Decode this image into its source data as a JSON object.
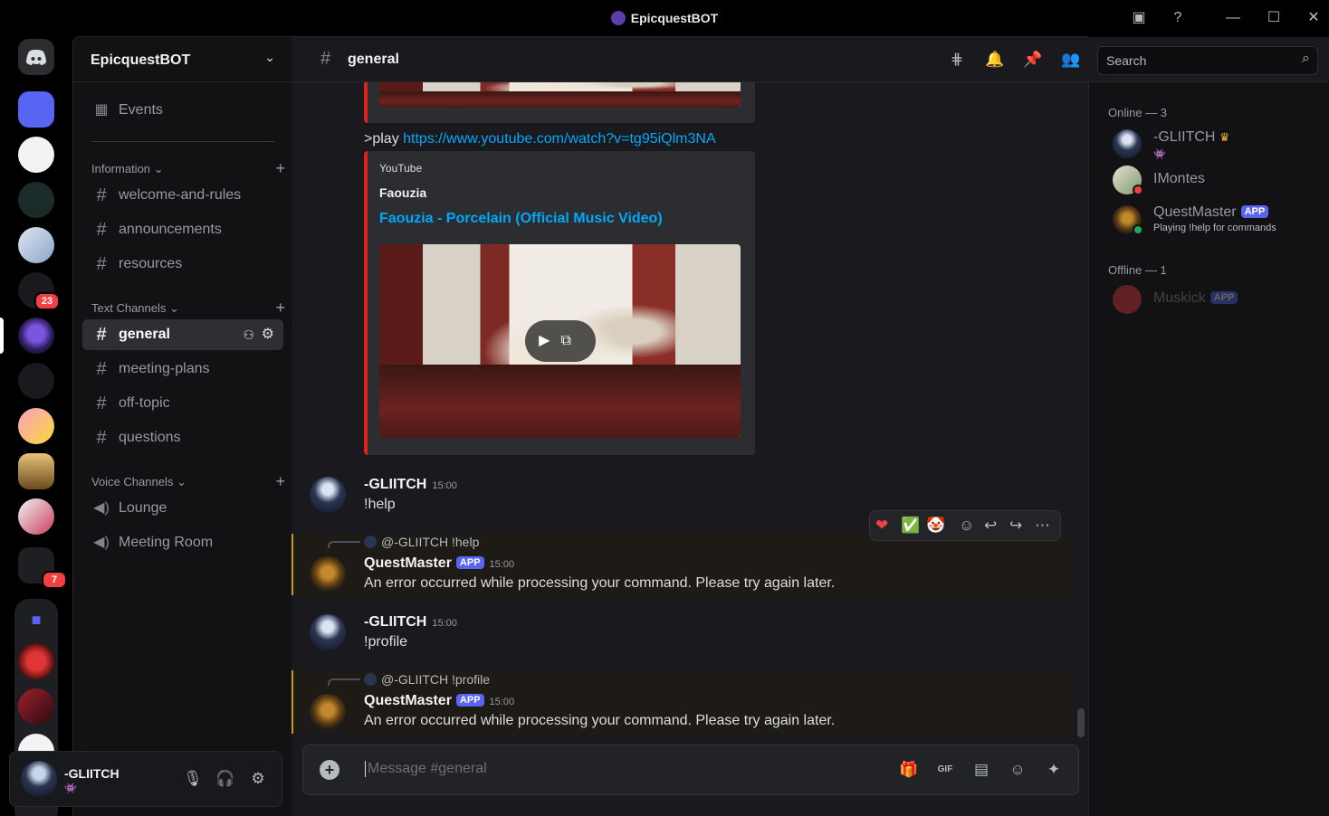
{
  "window": {
    "title": "EpicquestBOT"
  },
  "server": {
    "name": "EpicquestBOT"
  },
  "sidebar": {
    "events_label": "Events",
    "categories": [
      {
        "label": "Information ⌄",
        "channels": [
          "welcome-and-rules",
          "announcements",
          "resources"
        ]
      },
      {
        "label": "Text Channels ⌄",
        "channels": [
          "general",
          "meeting-plans",
          "off-topic",
          "questions"
        ]
      },
      {
        "label": "Voice Channels ⌄",
        "channels": [
          "Lounge",
          "Meeting Room"
        ]
      }
    ]
  },
  "rail": {
    "badges": [
      "23",
      "7"
    ]
  },
  "user": {
    "name": "-GLIITCH"
  },
  "channel": {
    "name": "general"
  },
  "search": {
    "placeholder": "Search"
  },
  "messages": {
    "play_prefix": ">play ",
    "play_link": "https://www.youtube.com/watch?v=tg95iQlm3NA",
    "embed": {
      "provider": "YouTube",
      "author": "Faouzia",
      "title": "Faouzia - Porcelain (Official Music Video)"
    },
    "list": [
      {
        "author": "-GLIITCH",
        "time": "15:00",
        "text": "!help"
      },
      {
        "reply": "@-GLIITCH !help",
        "author": "QuestMaster",
        "tag": "APP",
        "time": "15:00",
        "text": "An error occurred while processing your command. Please try again later."
      },
      {
        "author": "-GLIITCH",
        "time": "15:00",
        "text": "!profile"
      },
      {
        "reply": "@-GLIITCH !profile",
        "author": "QuestMaster",
        "tag": "APP",
        "time": "15:00",
        "text": "An error occurred while processing your command. Please try again later."
      }
    ]
  },
  "composer": {
    "placeholder": "Message #general"
  },
  "members": {
    "online_header": "Online — 3",
    "offline_header": "Offline — 1",
    "online": [
      {
        "name": "-GLIITCH",
        "status": ""
      },
      {
        "name": "IMontes",
        "status": ""
      },
      {
        "name": "QuestMaster",
        "tag": "APP",
        "status": "Playing !help for commands"
      }
    ],
    "offline": [
      {
        "name": "Muskick",
        "tag": "APP"
      }
    ]
  },
  "colors": {
    "accent": "#5865f2",
    "link": "#00a8fc",
    "embed_border": "#e0201b",
    "mention_bg": "#1e1b16"
  }
}
